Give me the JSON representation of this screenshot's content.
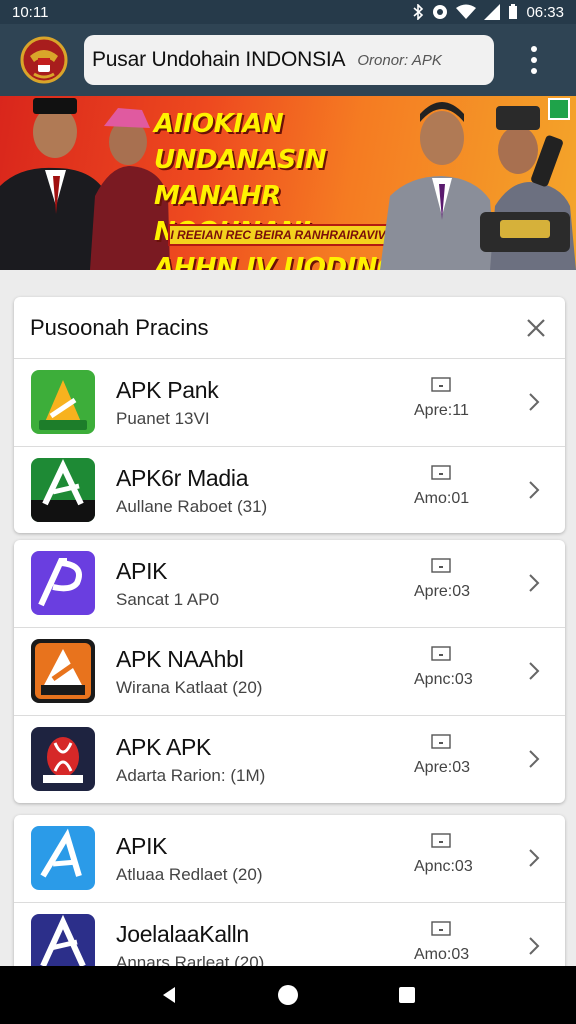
{
  "status_bar": {
    "time": "10:11",
    "right_time": "06:33"
  },
  "app_bar": {
    "title": "Pusar Undohain INDONSIA",
    "subtitle": "Oronor: APK"
  },
  "banner": {
    "line1": "AIIOKIAN UNDANASIN",
    "line2": "MANAHR NOOUNANI",
    "line3": "AHHN IV UODING",
    "tagline": "I REEIAN REC BEIRA RANHRAIRAVIV"
  },
  "card": {
    "title": "Pusoonah Pracins"
  },
  "apps": [
    {
      "name": "APK Pank",
      "subtitle": "Puanet 13VI",
      "meta": "Apre:11",
      "icon_color": "#3dae3a"
    },
    {
      "name": "APK6r Madia",
      "subtitle": "Aullane Raboet (31)",
      "meta": "Amo:01",
      "icon_color": "#1e8a35"
    },
    {
      "name": "APIK",
      "subtitle": "Sancat 1 AP0",
      "meta": "Apre:03",
      "icon_color": "#6a3ee0"
    },
    {
      "name": "APK NAAhbl",
      "subtitle": "Wirana Katlaat (20)",
      "meta": "Apnc:03",
      "icon_color": "#e8731d"
    },
    {
      "name": "APK APK",
      "subtitle": "Adarta Rarion: (1M)",
      "meta": "Apre:03",
      "icon_color": "#1e2340"
    },
    {
      "name": "APIK",
      "subtitle": "Atluaa Redlaet (20)",
      "meta": "Apnc:03",
      "icon_color": "#2b9be8"
    },
    {
      "name": "JoelalaaKalln",
      "subtitle": "Annars Rarleat (20)",
      "meta": "Amo:03",
      "icon_color": "#2c2f8a"
    }
  ],
  "icons": {
    "close": "close-icon",
    "chevron": "chevron-right-icon",
    "meta": "window-icon",
    "nav": [
      "back-icon",
      "home-icon",
      "recents-icon"
    ]
  }
}
